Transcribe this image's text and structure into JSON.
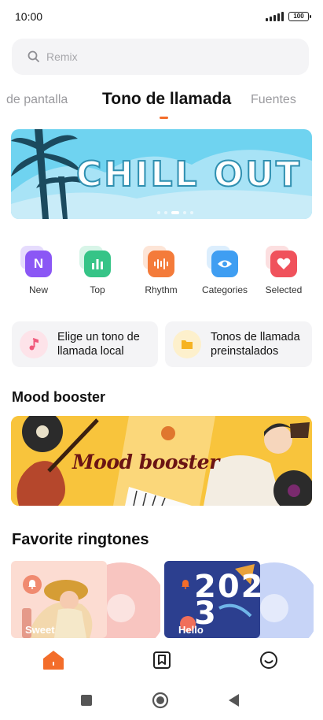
{
  "status": {
    "time": "10:00",
    "battery": "100"
  },
  "search": {
    "placeholder": "Remix"
  },
  "tabs": [
    {
      "label": "de pantalla"
    },
    {
      "label": "Tono de llamada"
    },
    {
      "label": "Fuentes"
    }
  ],
  "banner": {
    "title": "CHILL OUT",
    "page_count": 5,
    "active_page": 3
  },
  "categories": [
    {
      "label": "New",
      "icon": "n-letter-icon",
      "color": "#8b57f5"
    },
    {
      "label": "Top",
      "icon": "bar-chart-icon",
      "color": "#36c487"
    },
    {
      "label": "Rhythm",
      "icon": "waveform-icon",
      "color": "#f47b3a"
    },
    {
      "label": "Categories",
      "icon": "eye-icon",
      "color": "#3f9ef2"
    },
    {
      "label": "Selected",
      "icon": "heart-icon",
      "color": "#f0525c"
    }
  ],
  "cards": [
    {
      "line1": "Elige un tono de",
      "line2": "llamada local",
      "icon": "music-note-icon",
      "color": "#f0587a"
    },
    {
      "line1": "Tonos de llamada",
      "line2": "preinstalados",
      "icon": "folder-icon",
      "color": "#f6b321"
    }
  ],
  "mood": {
    "section_title": "Mood booster",
    "banner_text": "Mood booster"
  },
  "favorites": {
    "section_title": "Favorite ringtones",
    "items": [
      {
        "label": "Sweet",
        "icon": "bell-icon"
      },
      {
        "label": "Hello",
        "icon": "bell-icon",
        "art_text": "2023"
      }
    ]
  },
  "bottom_nav": [
    {
      "icon": "home-icon",
      "active": true,
      "color": "#f36d2a"
    },
    {
      "icon": "bookmark-icon",
      "active": false
    },
    {
      "icon": "smiley-icon",
      "active": false
    }
  ],
  "system_nav": [
    {
      "icon": "recents-square-icon"
    },
    {
      "icon": "home-circle-icon"
    },
    {
      "icon": "back-triangle-icon"
    }
  ]
}
